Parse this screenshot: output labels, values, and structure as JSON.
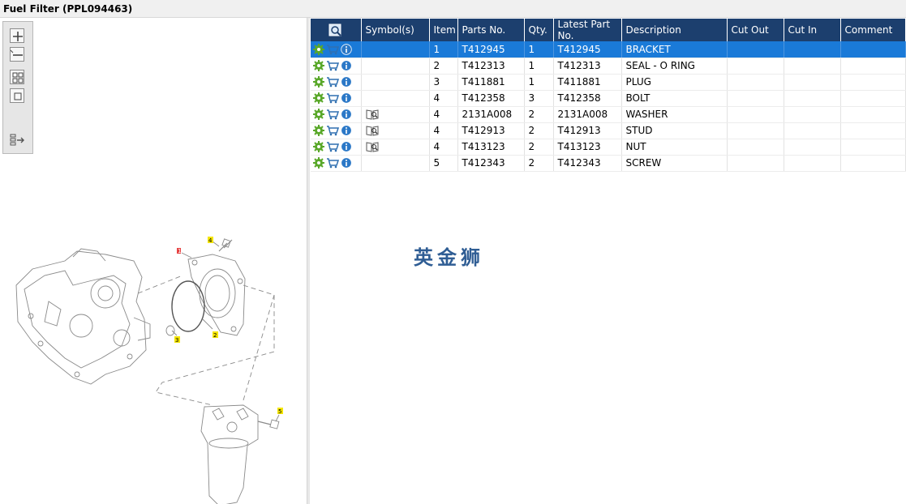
{
  "title": "Fuel Filter (PPL094463)",
  "toolbar": {
    "zoom_in": "zoom-in-icon",
    "zoom_out": "zoom-out-icon",
    "fit": "fit-page-icon",
    "actual": "actual-size-icon",
    "export": "export-icon"
  },
  "diagram": {
    "callouts": [
      "1",
      "2",
      "3",
      "4",
      "5"
    ],
    "callout_color": "#f5e600",
    "selected_callout_color": "#e64040"
  },
  "table": {
    "headers": [
      "",
      "Symbol(s)",
      "Item",
      "Parts No.",
      "Qty.",
      "Latest Part No.",
      "Description",
      "Cut Out",
      "Cut In",
      "Comment"
    ],
    "rows": [
      {
        "symbol": false,
        "item": "1",
        "part": "T412945",
        "qty": "1",
        "latest": "T412945",
        "desc": "BRACKET",
        "cut_out": "",
        "cut_in": "",
        "comment": ""
      },
      {
        "symbol": false,
        "item": "2",
        "part": "T412313",
        "qty": "1",
        "latest": "T412313",
        "desc": "SEAL - O RING",
        "cut_out": "",
        "cut_in": "",
        "comment": ""
      },
      {
        "symbol": false,
        "item": "3",
        "part": "T411881",
        "qty": "1",
        "latest": "T411881",
        "desc": "PLUG",
        "cut_out": "",
        "cut_in": "",
        "comment": ""
      },
      {
        "symbol": false,
        "item": "4",
        "part": "T412358",
        "qty": "3",
        "latest": "T412358",
        "desc": "BOLT",
        "cut_out": "",
        "cut_in": "",
        "comment": ""
      },
      {
        "symbol": true,
        "item": "4",
        "part": "2131A008",
        "qty": "2",
        "latest": "2131A008",
        "desc": "WASHER",
        "cut_out": "",
        "cut_in": "",
        "comment": ""
      },
      {
        "symbol": true,
        "item": "4",
        "part": "T412913",
        "qty": "2",
        "latest": "T412913",
        "desc": "STUD",
        "cut_out": "",
        "cut_in": "",
        "comment": ""
      },
      {
        "symbol": true,
        "item": "4",
        "part": "T413123",
        "qty": "2",
        "latest": "T413123",
        "desc": "NUT",
        "cut_out": "",
        "cut_in": "",
        "comment": ""
      },
      {
        "symbol": false,
        "item": "5",
        "part": "T412343",
        "qty": "2",
        "latest": "T412343",
        "desc": "SCREW",
        "cut_out": "",
        "cut_in": "",
        "comment": ""
      }
    ],
    "selected_row": 0,
    "icons": [
      "gear-icon",
      "cart-icon",
      "info-icon"
    ],
    "symbol_icon": "book-search-icon",
    "header_icon": "search-list-icon"
  },
  "watermark": "英金狮",
  "colors": {
    "header_bg": "#1c3f6e",
    "selected_row": "#1a7ad8",
    "gear": "#5aa82a",
    "cart": "#2f6fb0",
    "info": "#2b78c7",
    "watermark": "#2f5d94"
  }
}
